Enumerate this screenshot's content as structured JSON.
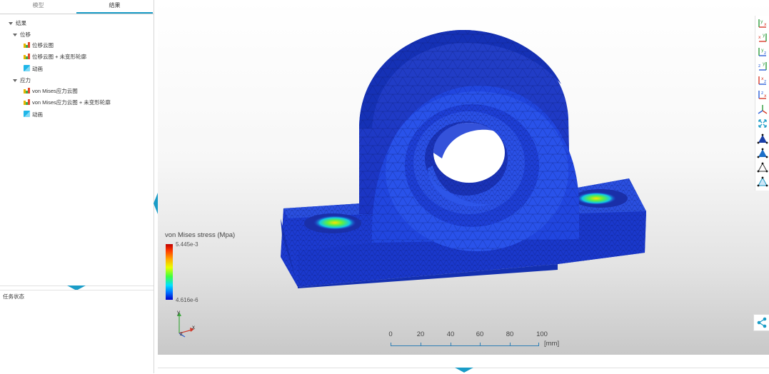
{
  "tabs": [
    {
      "label": "模型",
      "active": false
    },
    {
      "label": "结果",
      "active": true
    }
  ],
  "tree": {
    "root_label": "结果",
    "groups": [
      {
        "label": "位移",
        "items": [
          {
            "label": "位移云图",
            "icon": "contour-plot-icon"
          },
          {
            "label": "位移云图 + 未变形轮廓",
            "icon": "contour-plot-icon"
          },
          {
            "label": "动画",
            "icon": "animation-icon"
          }
        ]
      },
      {
        "label": "应力",
        "items": [
          {
            "label": "von Mises应力云图",
            "icon": "contour-plot-icon"
          },
          {
            "label": "von Mises应力云图 + 未变形轮廓",
            "icon": "contour-plot-icon"
          },
          {
            "label": "动画",
            "icon": "animation-icon"
          }
        ]
      }
    ]
  },
  "task_status": {
    "label": "任务状态"
  },
  "legend": {
    "title": "von Mises stress (Mpa)",
    "max": "5.445e-3",
    "min": "4.616e-6"
  },
  "triad": {
    "x": "x",
    "y": "y",
    "z": "z"
  },
  "scale_bar": {
    "labels": [
      "0",
      "20",
      "40",
      "60",
      "80",
      "100"
    ],
    "unit": "[mm]"
  },
  "view_toolbar": [
    "view-front-icon",
    "view-back-icon",
    "view-top-icon",
    "view-bottom-icon",
    "view-left-icon",
    "view-right-icon",
    "view-iso-icon",
    "fit-view-icon",
    "display-shaded-icon",
    "display-shaded-edges-icon",
    "display-wireframe-icon",
    "display-mesh-icon"
  ],
  "colors": {
    "accent": "#1a9cc7",
    "model_blue": "#1e3fd6",
    "toolbar_green": "#2e9d3c",
    "toolbar_red": "#d83a2a",
    "toolbar_blue": "#2b5fd9"
  }
}
